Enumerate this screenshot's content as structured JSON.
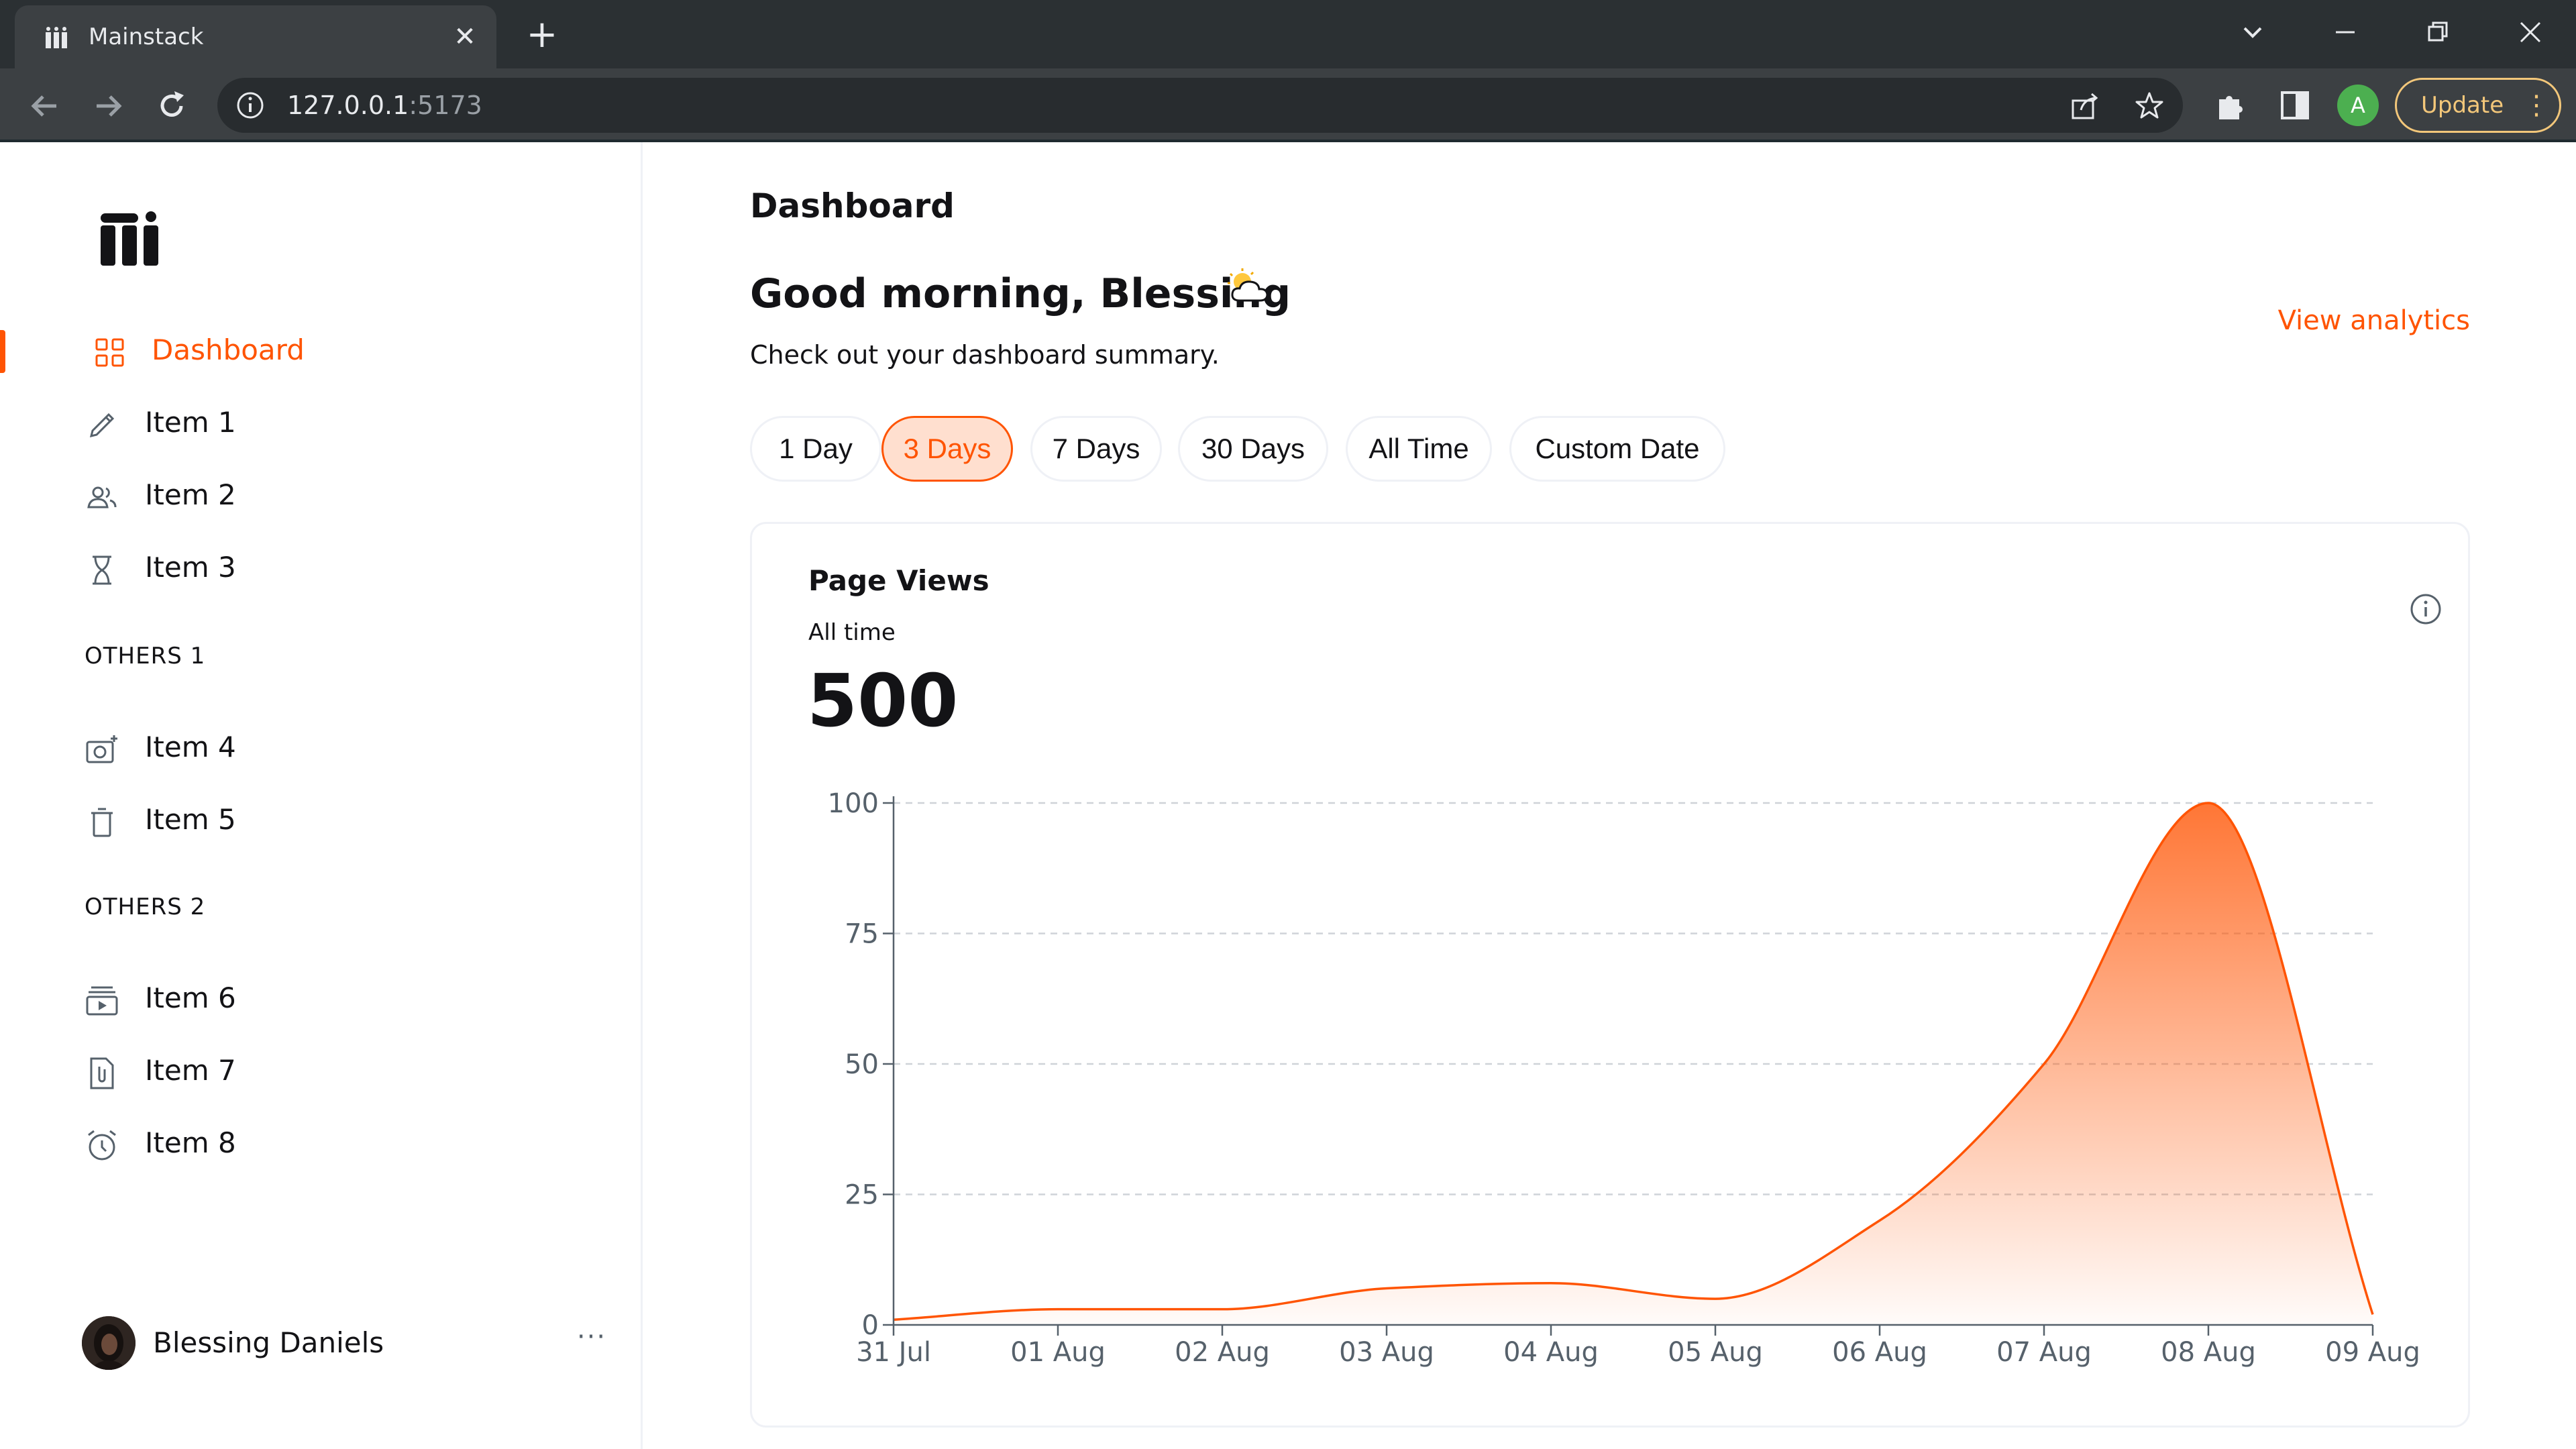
{
  "browser": {
    "tab_title": "Mainstack",
    "tab_close": "✕",
    "new_tab": "+",
    "url_host": "127.0.0.1",
    "url_port": ":5173",
    "profile_initial": "A",
    "update_label": "Update",
    "menu_dots": "⋮"
  },
  "sidebar": {
    "nav": [
      {
        "label": "Dashboard",
        "icon": "grid-icon",
        "active": true
      },
      {
        "label": "Item 1",
        "icon": "pencil-icon"
      },
      {
        "label": "Item 2",
        "icon": "users-icon"
      },
      {
        "label": "Item 3",
        "icon": "hourglass-icon"
      }
    ],
    "section1": "OTHERS 1",
    "nav2": [
      {
        "label": "Item 4",
        "icon": "camera-add-icon"
      },
      {
        "label": "Item 5",
        "icon": "trash-icon"
      }
    ],
    "section2": "OTHERS 2",
    "nav3": [
      {
        "label": "Item 6",
        "icon": "video-library-icon"
      },
      {
        "label": "Item 7",
        "icon": "file-clip-icon"
      },
      {
        "label": "Item 8",
        "icon": "alarm-clock-icon"
      }
    ],
    "user": {
      "name": "Blessing Daniels",
      "more": "···"
    }
  },
  "main": {
    "page_title": "Dashboard",
    "greeting": "Good morning, Blessing",
    "subtitle": "Check out your dashboard summary.",
    "view_analytics": "View analytics",
    "filters": [
      "1 Day",
      "3 Days",
      "7 Days",
      "30 Days",
      "All Time",
      "Custom Date"
    ],
    "selected_filter": "3 Days"
  },
  "card": {
    "title": "Page Views",
    "subtitle": "All time",
    "value": "500"
  },
  "colors": {
    "accent": "#ff5403",
    "accent_light": "#ffdfcf"
  },
  "chart_data": {
    "type": "area",
    "x": [
      "31 Jul",
      "01 Aug",
      "02 Aug",
      "03 Aug",
      "04 Aug",
      "05 Aug",
      "06 Aug",
      "07 Aug",
      "08 Aug",
      "09 Aug"
    ],
    "series": [
      {
        "values": [
          1,
          3,
          3,
          7,
          8,
          5,
          20,
          50,
          100,
          2
        ]
      }
    ],
    "ylim": [
      0,
      100
    ],
    "yticks": [
      0,
      25,
      50,
      75,
      100
    ],
    "grid": true
  }
}
